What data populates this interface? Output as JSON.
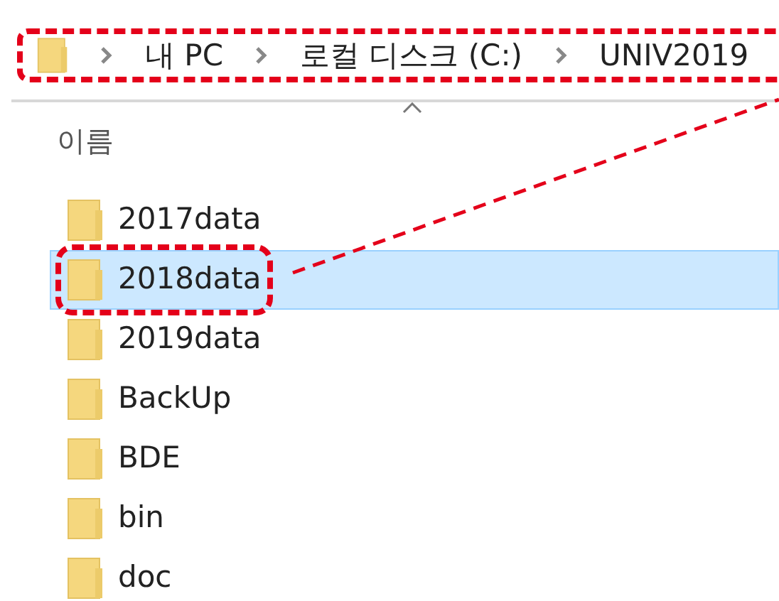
{
  "breadcrumb": {
    "highlighted": true,
    "parts": [
      "내 PC",
      "로컬 디스크 (C:)",
      "UNIV2019"
    ]
  },
  "column_header": {
    "label": "이름",
    "sorted": true
  },
  "items": [
    {
      "name": "2017data",
      "selected": false,
      "highlighted": false
    },
    {
      "name": "2018data",
      "selected": true,
      "highlighted": true
    },
    {
      "name": "2019data",
      "selected": false,
      "highlighted": false
    },
    {
      "name": "BackUp",
      "selected": false,
      "highlighted": false
    },
    {
      "name": "BDE",
      "selected": false,
      "highlighted": false
    },
    {
      "name": "bin",
      "selected": false,
      "highlighted": false
    },
    {
      "name": "doc",
      "selected": false,
      "highlighted": false
    }
  ]
}
